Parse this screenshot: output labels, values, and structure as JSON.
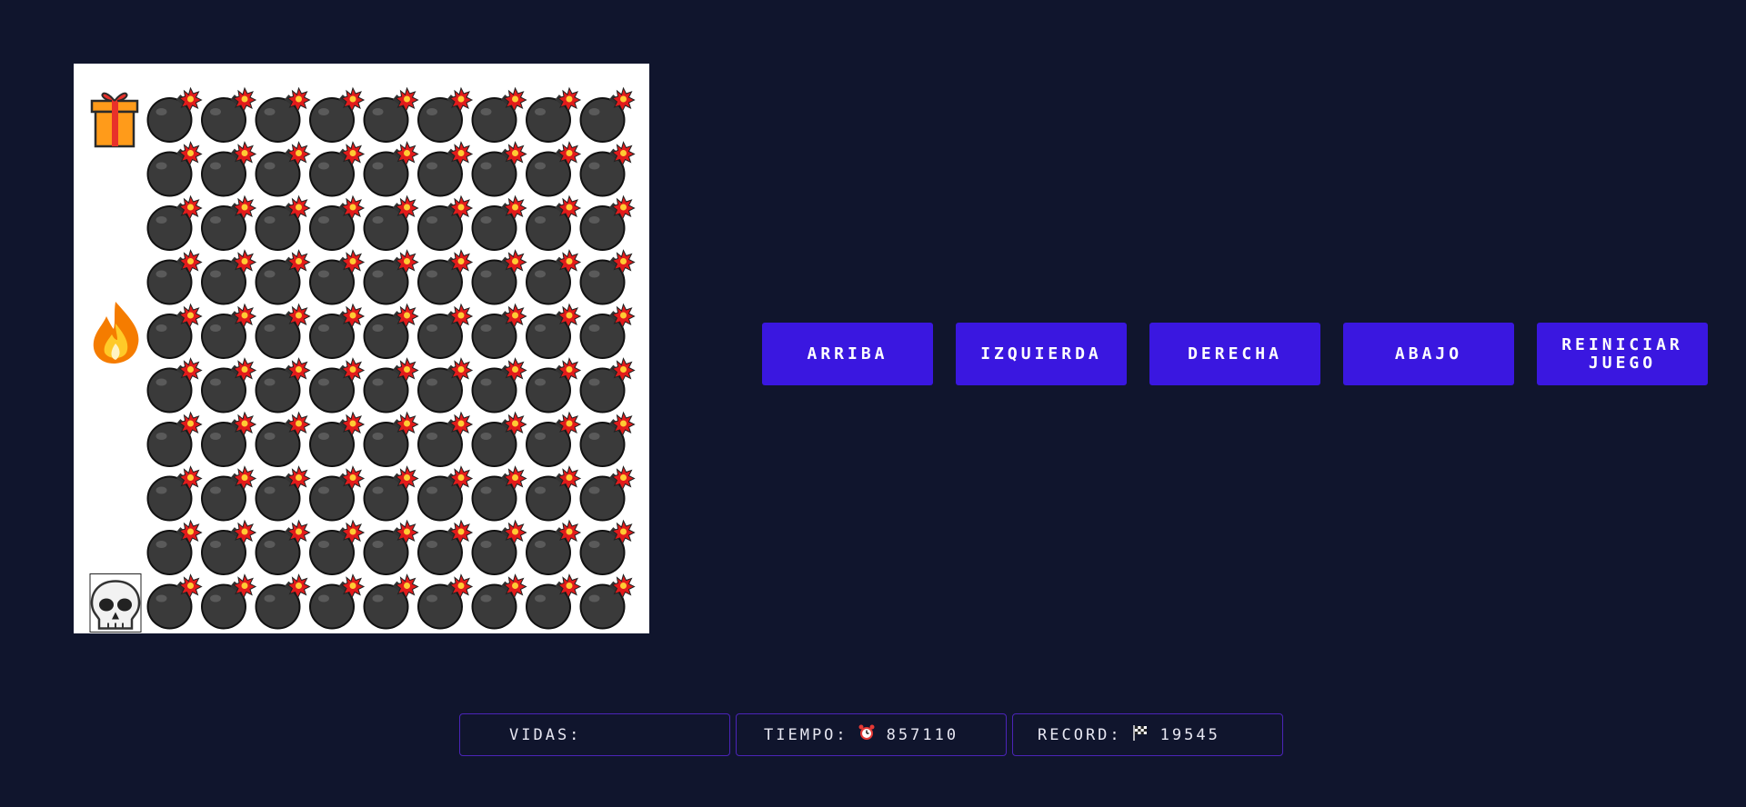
{
  "controls": {
    "up": "ARRIBA",
    "left": "IZQUIERDA",
    "right": "DERECHA",
    "down": "ABAJO",
    "restart_line1": "REINICIAR",
    "restart_line2": "JUEGO"
  },
  "stats": {
    "lives_label": "VIDAS:",
    "time_label": "TIEMPO:",
    "time_icon": "alarm-clock-icon",
    "time_value": "857110",
    "record_label": "RECORD:",
    "record_icon": "checkered-flag-icon",
    "record_value": "19545"
  },
  "board": {
    "rows": 10,
    "cols": 10,
    "legend": {
      "G": "gift",
      "B": "bomb",
      "F": "fire",
      "S": "skull",
      ".": "empty"
    },
    "grid": [
      "GBBBBBBBBB",
      ".BBBBBBBBB",
      ".BBBBBBBBB",
      ".BBBBBBBBB",
      "FBBBBBBBBB",
      ".BBBBBBBBB",
      ".BBBBBBBBB",
      ".BBBBBBBBB",
      ".BBBBBBBBB",
      "SBBBBBBBBB"
    ]
  },
  "colors": {
    "background": "#10152d",
    "button": "#3a17e0",
    "board": "#ffffff",
    "stat_border": "#4b24b8"
  }
}
